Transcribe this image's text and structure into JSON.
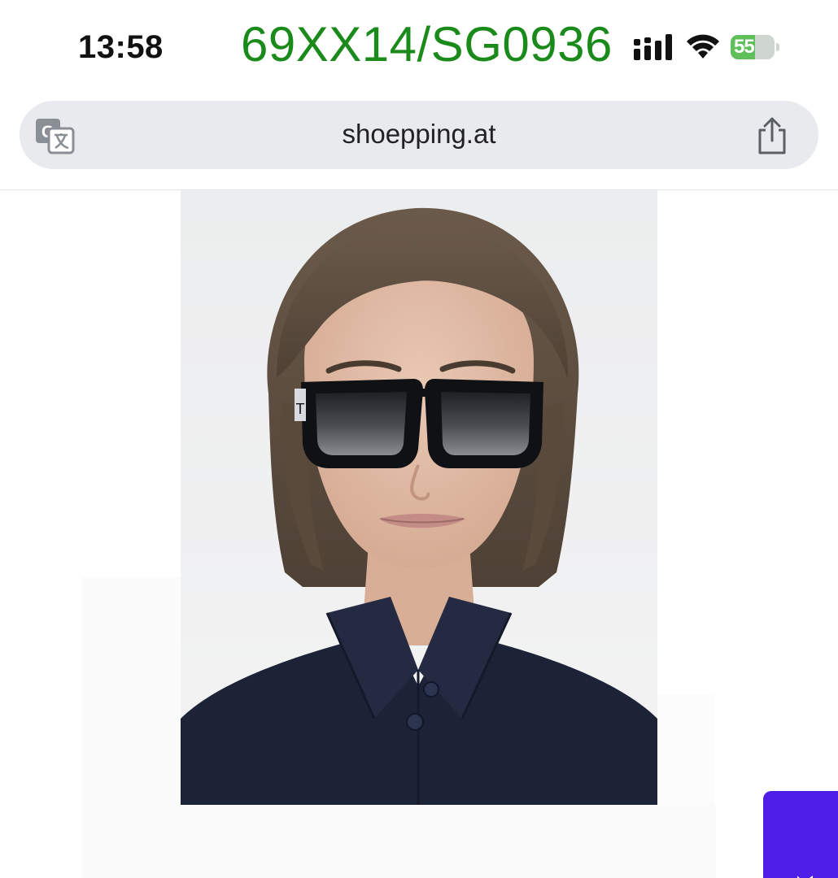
{
  "status_bar": {
    "time": "13:58",
    "overlay_code": "69XX14/SG0936",
    "battery_level": "55",
    "battery_fraction": 0.55,
    "battery_charging": true,
    "colors": {
      "overlay_code": "#1a8a1a",
      "battery": "#5fbf5a"
    }
  },
  "address_bar": {
    "url": "shoepping.at",
    "left_icon": "translate-icon",
    "right_icon": "share-icon"
  },
  "content": {
    "product_image": "model-wearing-black-square-sunglasses"
  },
  "feedback_tab": {
    "label": "ack",
    "color": "#4f1de8"
  }
}
